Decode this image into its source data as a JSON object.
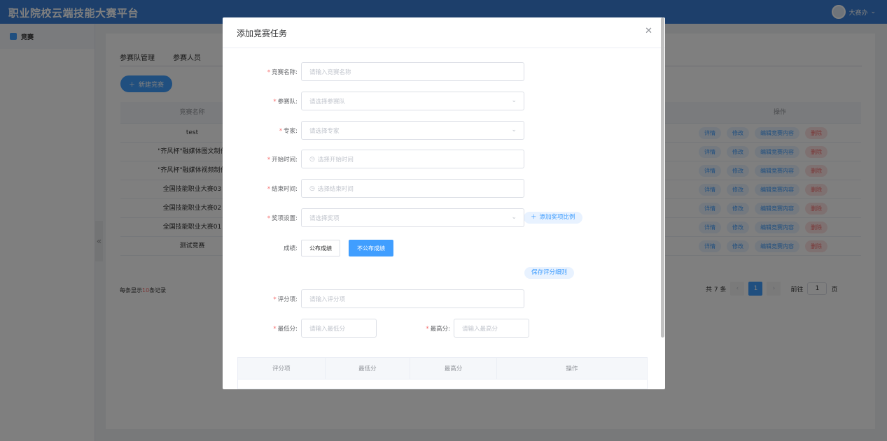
{
  "app": {
    "title": "职业院校云端技能大赛平台",
    "user_name": "大赛办"
  },
  "sidebar": {
    "items": [
      {
        "label": "竞赛"
      }
    ]
  },
  "tabs": [
    {
      "label": "参赛队管理"
    },
    {
      "label": "参赛人员"
    }
  ],
  "toolbar": {
    "new_label": "新建竞赛"
  },
  "table": {
    "columns": {
      "name": "竞赛名称",
      "ops": "操作"
    },
    "rows": [
      {
        "name": "test"
      },
      {
        "name": "\"齐风杯\"融媒体图文制作"
      },
      {
        "name": "\"齐风杯\"融媒体视频制作"
      },
      {
        "name": "全国技能职业大赛03"
      },
      {
        "name": "全国技能职业大赛02"
      },
      {
        "name": "全国技能职业大赛01"
      },
      {
        "name": "测试竞赛"
      }
    ],
    "actions": {
      "detail": "详情",
      "edit": "修改",
      "edit_content": "编辑竞赛内容",
      "delete": "删除"
    }
  },
  "footer": {
    "per_page_prefix": "每条显示",
    "per_page_num": "10",
    "per_page_suffix": "条记录",
    "total": "共 7 条",
    "current_page": "1",
    "goto_label": "前往",
    "goto_value": "1",
    "page_unit": "页"
  },
  "dialog": {
    "title": "添加竞赛任务",
    "fields": {
      "name": {
        "label": "竞赛名称:",
        "placeholder": "请输入竞赛名称"
      },
      "team": {
        "label": "参赛队:",
        "placeholder": "请选择参赛队"
      },
      "expert": {
        "label": "专家:",
        "placeholder": "请选择专家"
      },
      "start": {
        "label": "开始时间:",
        "placeholder": "选择开始时间"
      },
      "end": {
        "label": "结束时间:",
        "placeholder": "选择结束时间"
      },
      "award": {
        "label": "奖项设置:",
        "placeholder": "请选择奖项"
      },
      "score": {
        "label": "成绩:"
      },
      "item": {
        "label": "评分项:",
        "placeholder": "请输入评分项"
      },
      "min": {
        "label": "最低分:",
        "placeholder": "请输入最低分"
      },
      "max": {
        "label": "最高分:",
        "placeholder": "请输入最高分"
      }
    },
    "add_award_label": "添加奖项比例",
    "score_options": {
      "publish": "公布成绩",
      "unpublish": "不公布成绩",
      "selected": "不公布成绩"
    },
    "save_rule_label": "保存评分细则",
    "rule_table": {
      "columns": [
        "评分项",
        "最低分",
        "最高分",
        "操作"
      ]
    }
  }
}
